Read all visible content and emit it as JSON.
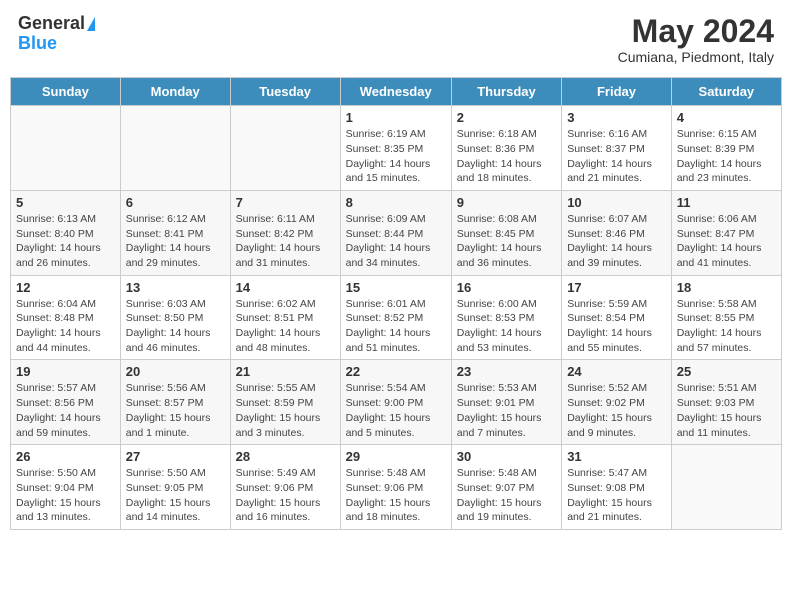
{
  "header": {
    "logo_general": "General",
    "logo_blue": "Blue",
    "title": "May 2024",
    "location": "Cumiana, Piedmont, Italy"
  },
  "days_of_week": [
    "Sunday",
    "Monday",
    "Tuesday",
    "Wednesday",
    "Thursday",
    "Friday",
    "Saturday"
  ],
  "weeks": [
    [
      {
        "day": "",
        "info": ""
      },
      {
        "day": "",
        "info": ""
      },
      {
        "day": "",
        "info": ""
      },
      {
        "day": "1",
        "info": "Sunrise: 6:19 AM\nSunset: 8:35 PM\nDaylight: 14 hours\nand 15 minutes."
      },
      {
        "day": "2",
        "info": "Sunrise: 6:18 AM\nSunset: 8:36 PM\nDaylight: 14 hours\nand 18 minutes."
      },
      {
        "day": "3",
        "info": "Sunrise: 6:16 AM\nSunset: 8:37 PM\nDaylight: 14 hours\nand 21 minutes."
      },
      {
        "day": "4",
        "info": "Sunrise: 6:15 AM\nSunset: 8:39 PM\nDaylight: 14 hours\nand 23 minutes."
      }
    ],
    [
      {
        "day": "5",
        "info": "Sunrise: 6:13 AM\nSunset: 8:40 PM\nDaylight: 14 hours\nand 26 minutes."
      },
      {
        "day": "6",
        "info": "Sunrise: 6:12 AM\nSunset: 8:41 PM\nDaylight: 14 hours\nand 29 minutes."
      },
      {
        "day": "7",
        "info": "Sunrise: 6:11 AM\nSunset: 8:42 PM\nDaylight: 14 hours\nand 31 minutes."
      },
      {
        "day": "8",
        "info": "Sunrise: 6:09 AM\nSunset: 8:44 PM\nDaylight: 14 hours\nand 34 minutes."
      },
      {
        "day": "9",
        "info": "Sunrise: 6:08 AM\nSunset: 8:45 PM\nDaylight: 14 hours\nand 36 minutes."
      },
      {
        "day": "10",
        "info": "Sunrise: 6:07 AM\nSunset: 8:46 PM\nDaylight: 14 hours\nand 39 minutes."
      },
      {
        "day": "11",
        "info": "Sunrise: 6:06 AM\nSunset: 8:47 PM\nDaylight: 14 hours\nand 41 minutes."
      }
    ],
    [
      {
        "day": "12",
        "info": "Sunrise: 6:04 AM\nSunset: 8:48 PM\nDaylight: 14 hours\nand 44 minutes."
      },
      {
        "day": "13",
        "info": "Sunrise: 6:03 AM\nSunset: 8:50 PM\nDaylight: 14 hours\nand 46 minutes."
      },
      {
        "day": "14",
        "info": "Sunrise: 6:02 AM\nSunset: 8:51 PM\nDaylight: 14 hours\nand 48 minutes."
      },
      {
        "day": "15",
        "info": "Sunrise: 6:01 AM\nSunset: 8:52 PM\nDaylight: 14 hours\nand 51 minutes."
      },
      {
        "day": "16",
        "info": "Sunrise: 6:00 AM\nSunset: 8:53 PM\nDaylight: 14 hours\nand 53 minutes."
      },
      {
        "day": "17",
        "info": "Sunrise: 5:59 AM\nSunset: 8:54 PM\nDaylight: 14 hours\nand 55 minutes."
      },
      {
        "day": "18",
        "info": "Sunrise: 5:58 AM\nSunset: 8:55 PM\nDaylight: 14 hours\nand 57 minutes."
      }
    ],
    [
      {
        "day": "19",
        "info": "Sunrise: 5:57 AM\nSunset: 8:56 PM\nDaylight: 14 hours\nand 59 minutes."
      },
      {
        "day": "20",
        "info": "Sunrise: 5:56 AM\nSunset: 8:57 PM\nDaylight: 15 hours\nand 1 minute."
      },
      {
        "day": "21",
        "info": "Sunrise: 5:55 AM\nSunset: 8:59 PM\nDaylight: 15 hours\nand 3 minutes."
      },
      {
        "day": "22",
        "info": "Sunrise: 5:54 AM\nSunset: 9:00 PM\nDaylight: 15 hours\nand 5 minutes."
      },
      {
        "day": "23",
        "info": "Sunrise: 5:53 AM\nSunset: 9:01 PM\nDaylight: 15 hours\nand 7 minutes."
      },
      {
        "day": "24",
        "info": "Sunrise: 5:52 AM\nSunset: 9:02 PM\nDaylight: 15 hours\nand 9 minutes."
      },
      {
        "day": "25",
        "info": "Sunrise: 5:51 AM\nSunset: 9:03 PM\nDaylight: 15 hours\nand 11 minutes."
      }
    ],
    [
      {
        "day": "26",
        "info": "Sunrise: 5:50 AM\nSunset: 9:04 PM\nDaylight: 15 hours\nand 13 minutes."
      },
      {
        "day": "27",
        "info": "Sunrise: 5:50 AM\nSunset: 9:05 PM\nDaylight: 15 hours\nand 14 minutes."
      },
      {
        "day": "28",
        "info": "Sunrise: 5:49 AM\nSunset: 9:06 PM\nDaylight: 15 hours\nand 16 minutes."
      },
      {
        "day": "29",
        "info": "Sunrise: 5:48 AM\nSunset: 9:06 PM\nDaylight: 15 hours\nand 18 minutes."
      },
      {
        "day": "30",
        "info": "Sunrise: 5:48 AM\nSunset: 9:07 PM\nDaylight: 15 hours\nand 19 minutes."
      },
      {
        "day": "31",
        "info": "Sunrise: 5:47 AM\nSunset: 9:08 PM\nDaylight: 15 hours\nand 21 minutes."
      },
      {
        "day": "",
        "info": ""
      }
    ]
  ]
}
